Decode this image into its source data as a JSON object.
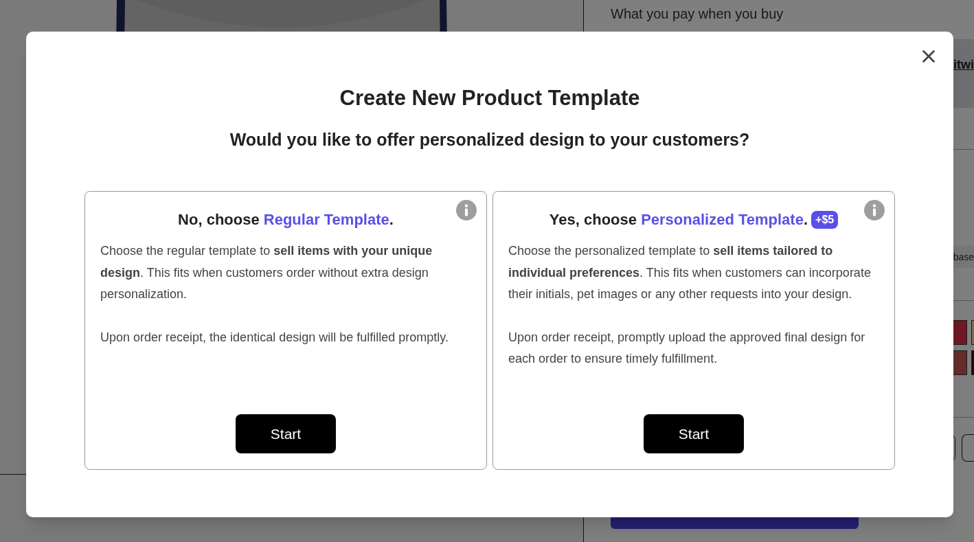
{
  "background": {
    "price_caption": "What you pay when you buy",
    "link_fragment": "itwi",
    "label_fragment": "base"
  },
  "dialog": {
    "title": "Create New Product Template",
    "subtitle": "Would you like to offer personalized design to your customers?",
    "options": [
      {
        "prefix": "No, choose ",
        "link": "Regular Template",
        "suffix": ".",
        "paragraphs": [
          "Choose the regular template to **sell items with your unique design**. This fits when customers order without extra design personalization.",
          "Upon order receipt, the identical design will be fulfilled promptly."
        ],
        "button": "Start"
      },
      {
        "prefix": "Yes, choose ",
        "link": "Personalized Template",
        "suffix": ".",
        "badge": "+$5",
        "paragraphs": [
          "Choose the personalized template to **sell items tailored to individual preferences**. This fits when customers can incorporate their initials, pet images or any other requests into your design.",
          "Upon order receipt, promptly upload the approved final design for each order to ensure timely fulfillment."
        ],
        "button": "Start"
      }
    ]
  }
}
